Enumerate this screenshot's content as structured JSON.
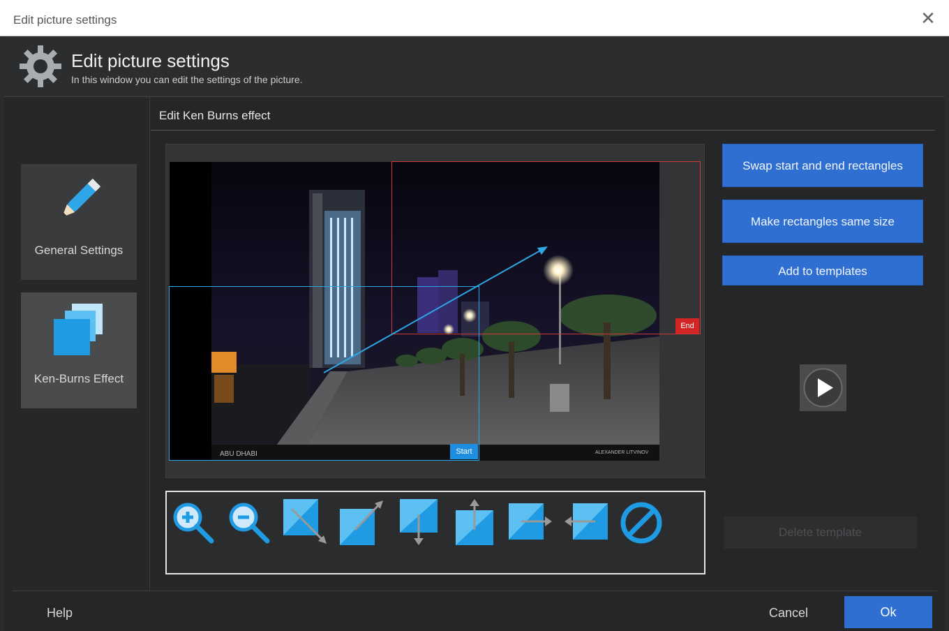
{
  "window": {
    "title": "Edit picture settings",
    "close_icon": "close-icon"
  },
  "header": {
    "title": "Edit picture settings",
    "subtitle": "In this window you can edit the settings of the picture."
  },
  "sidebar": {
    "items": [
      {
        "label": "General Settings",
        "icon": "pen-icon"
      },
      {
        "label": "Ken-Burns Effect",
        "icon": "ken-burns-icon"
      }
    ]
  },
  "section": {
    "title": "Edit Ken Burns effect"
  },
  "preview": {
    "end_label": "End",
    "start_label": "Start",
    "photo_caption_left": "ABU DHABI",
    "photo_caption_right": "ALEXANDER LITVINOV"
  },
  "tools": [
    {
      "icon": "zoom-in-icon"
    },
    {
      "icon": "zoom-out-icon"
    },
    {
      "icon": "shrink-diagonal-icon"
    },
    {
      "icon": "expand-diagonal-icon"
    },
    {
      "icon": "move-down-icon"
    },
    {
      "icon": "move-up-icon"
    },
    {
      "icon": "move-right-icon"
    },
    {
      "icon": "move-left-icon"
    },
    {
      "icon": "reset-icon"
    }
  ],
  "actions": {
    "swap": "Swap start and end rectangles",
    "same_size": "Make rectangles same size",
    "add_templates": "Add to templates",
    "delete_template": "Delete template",
    "play_icon": "play-icon"
  },
  "footer": {
    "help": "Help",
    "cancel": "Cancel",
    "ok": "Ok"
  },
  "colors": {
    "accent": "#2f6fd1",
    "end_rect": "#d23a3a",
    "start_rect": "#2ea7e6"
  }
}
